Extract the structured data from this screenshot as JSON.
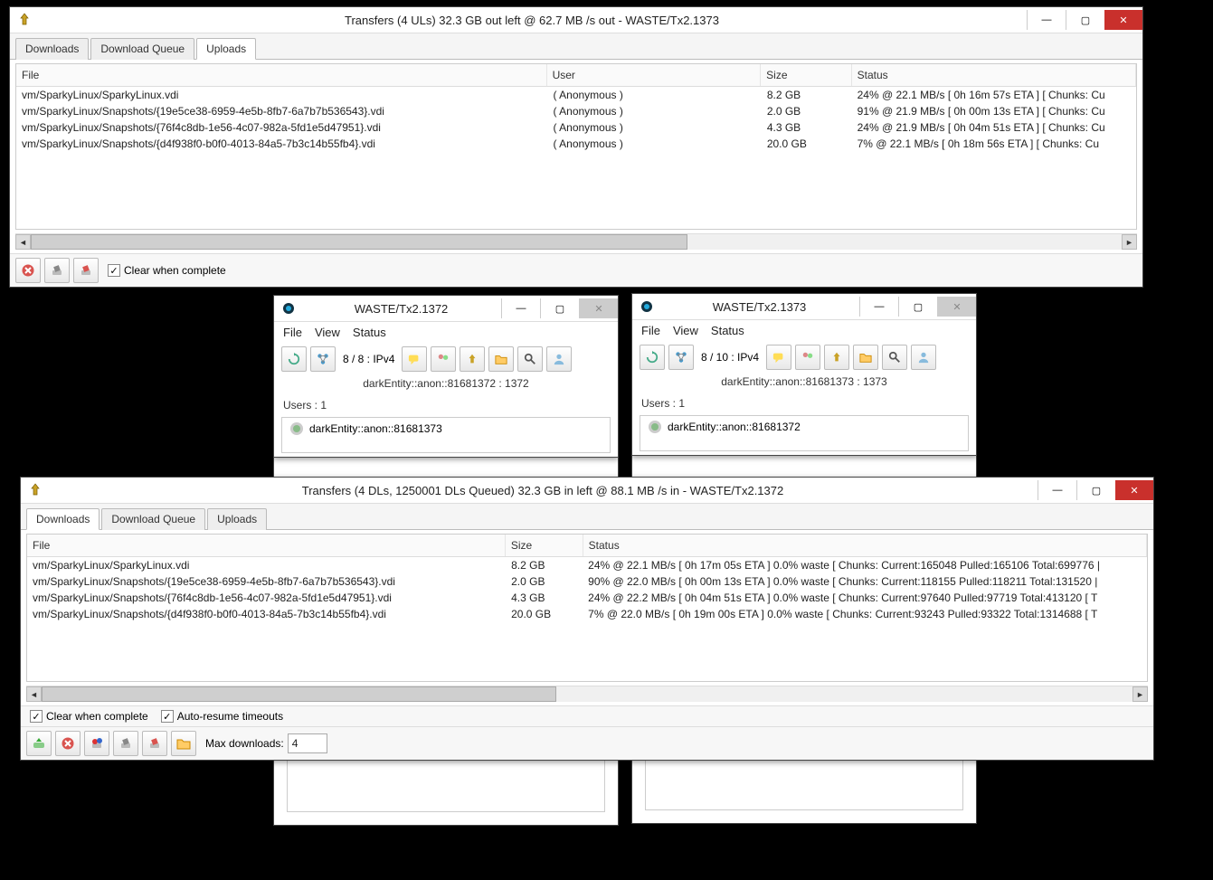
{
  "win_ul": {
    "title": "Transfers (4 ULs) 32.3 GB out left @ 62.7 MB /s out  - WASTE/Tx2.1373",
    "tabs": {
      "downloads": "Downloads",
      "queue": "Download Queue",
      "uploads": "Uploads"
    },
    "headers": {
      "file": "File",
      "user": "User",
      "size": "Size",
      "status": "Status"
    },
    "rows": [
      {
        "file": "vm/SparkyLinux/SparkyLinux.vdi",
        "user": "( Anonymous )",
        "size": "8.2 GB",
        "status": "24% @ 22.1 MB/s [ 0h 16m 57s ETA ] [ Chunks: Cu"
      },
      {
        "file": "vm/SparkyLinux/Snapshots/{19e5ce38-6959-4e5b-8fb7-6a7b7b536543}.vdi",
        "user": "( Anonymous )",
        "size": "2.0 GB",
        "status": "91% @ 21.9 MB/s [ 0h 00m 13s ETA ] [ Chunks: Cu"
      },
      {
        "file": "vm/SparkyLinux/Snapshots/{76f4c8db-1e56-4c07-982a-5fd1e5d47951}.vdi",
        "user": "( Anonymous )",
        "size": "4.3 GB",
        "status": "24% @ 21.9 MB/s [ 0h 04m 51s ETA ] [ Chunks: Cu"
      },
      {
        "file": "vm/SparkyLinux/Snapshots/{d4f938f0-b0f0-4013-84a5-7b3c14b55fb4}.vdi",
        "user": "( Anonymous )",
        "size": "20.0 GB",
        "status": "7% @ 22.1 MB/s [ 0h 18m 56s ETA ] [ Chunks: Cu"
      }
    ],
    "clear_label": "Clear when complete"
  },
  "win_a": {
    "title": "WASTE/Tx2.1372",
    "menu": {
      "file": "File",
      "view": "View",
      "status": "Status"
    },
    "netstat": "8 / 8 : IPv4",
    "ident": "darkEntity::anon::81681372 : 1372",
    "users_label": "Users : 1",
    "user": "darkEntity::anon::81681373"
  },
  "win_b": {
    "title": "WASTE/Tx2.1373",
    "menu": {
      "file": "File",
      "view": "View",
      "status": "Status"
    },
    "netstat": "8 / 10 : IPv4",
    "ident": "darkEntity::anon::81681373 : 1373",
    "users_label": "Users : 1",
    "user": "darkEntity::anon::81681372"
  },
  "win_dl": {
    "title": "Transfers (4 DLs, 1250001 DLs Queued) 32.3 GB in left @ 88.1 MB /s in  - WASTE/Tx2.1372",
    "tabs": {
      "downloads": "Downloads",
      "queue": "Download Queue",
      "uploads": "Uploads"
    },
    "headers": {
      "file": "File",
      "size": "Size",
      "status": "Status"
    },
    "rows": [
      {
        "file": "vm/SparkyLinux/SparkyLinux.vdi",
        "size": "8.2 GB",
        "status": "24% @ 22.1 MB/s [ 0h 17m 05s ETA ] 0.0% waste [ Chunks: Current:165048 Pulled:165106 Total:699776 |"
      },
      {
        "file": "vm/SparkyLinux/Snapshots/{19e5ce38-6959-4e5b-8fb7-6a7b7b536543}.vdi",
        "size": "2.0 GB",
        "status": "90% @ 22.0 MB/s [ 0h 00m 13s ETA ] 0.0% waste [ Chunks: Current:118155 Pulled:118211 Total:131520 |"
      },
      {
        "file": "vm/SparkyLinux/Snapshots/{76f4c8db-1e56-4c07-982a-5fd1e5d47951}.vdi",
        "size": "4.3 GB",
        "status": "24% @ 22.2 MB/s [ 0h 04m 51s ETA ] 0.0% waste [ Chunks: Current:97640 Pulled:97719 Total:413120 [ T"
      },
      {
        "file": "vm/SparkyLinux/Snapshots/{d4f938f0-b0f0-4013-84a5-7b3c14b55fb4}.vdi",
        "size": "20.0 GB",
        "status": "7% @ 22.0 MB/s [ 0h 19m 00s ETA ] 0.0% waste [ Chunks: Current:93243 Pulled:93322 Total:1314688 [ T"
      }
    ],
    "clear_label": "Clear when complete",
    "autores_label": "Auto-resume timeouts",
    "maxdl_label": "Max downloads:",
    "maxdl_value": "4"
  }
}
